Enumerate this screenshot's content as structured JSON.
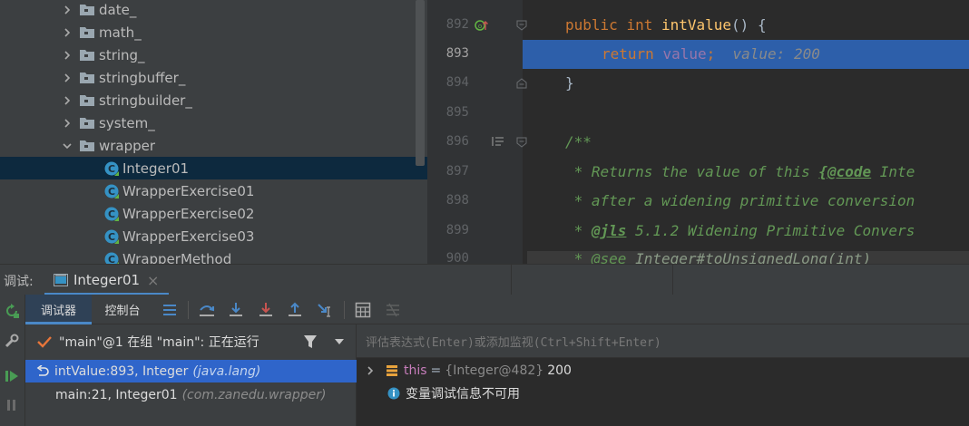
{
  "project_tree": {
    "items": [
      {
        "label": "date_",
        "kind": "folder",
        "expanded": false
      },
      {
        "label": "math_",
        "kind": "folder",
        "expanded": false
      },
      {
        "label": "string_",
        "kind": "folder",
        "expanded": false
      },
      {
        "label": "stringbuffer_",
        "kind": "folder",
        "expanded": false
      },
      {
        "label": "stringbuilder_",
        "kind": "folder",
        "expanded": false
      },
      {
        "label": "system_",
        "kind": "folder",
        "expanded": false
      },
      {
        "label": "wrapper",
        "kind": "folder",
        "expanded": true
      },
      {
        "label": "Integer01",
        "kind": "class",
        "selected": true
      },
      {
        "label": "WrapperExercise01",
        "kind": "class"
      },
      {
        "label": "WrapperExercise02",
        "kind": "class"
      },
      {
        "label": "WrapperExercise03",
        "kind": "class"
      },
      {
        "label": "WrapperMethod",
        "kind": "class"
      }
    ]
  },
  "editor": {
    "lines": [
      {
        "num": "892"
      },
      {
        "num": "893"
      },
      {
        "num": "894"
      },
      {
        "num": "895"
      },
      {
        "num": "896"
      },
      {
        "num": "897"
      },
      {
        "num": "898"
      },
      {
        "num": "899"
      },
      {
        "num": "900"
      }
    ],
    "code": {
      "l892_kw1": "public",
      "l892_kw2": "int",
      "l892_fn": "intValue",
      "l892_rest": "() {",
      "l893_kw": "return",
      "l893_var": "value",
      "l893_semi": ";",
      "l893_inline": "value: 200",
      "l894": "}",
      "l896": "/**",
      "l897_a": " * Returns the value of this ",
      "l897_tag": "{@code",
      "l897_b": " Inte",
      "l898": " * after a widening primitive conversion",
      "l899_a": " * ",
      "l899_tag": "@jls",
      "l899_b": " 5.1.2 Widening Primitive Convers",
      "l900_a": " * @see ",
      "l900_b": "Integer#toUnsignedLong(int)"
    }
  },
  "debug": {
    "title": "调试:",
    "session_tab": "Integer01",
    "close_glyph": "×",
    "tabs": {
      "debugger": "调试器",
      "console": "控制台"
    },
    "thread": "\"main\"@1 在组 \"main\": 正在运行",
    "frames": [
      {
        "name": "intValue:893, Integer",
        "pkg": "(java.lang)",
        "selected": true
      },
      {
        "name": "main:21, Integer01",
        "pkg": "(com.zanedu.wrapper)",
        "selected": false
      }
    ],
    "watch_placeholder": "评估表达式(Enter)或添加监视(Ctrl+Shift+Enter)",
    "variables": {
      "this_name": "this",
      "this_eq": "=",
      "this_type": "{Integer@482}",
      "this_value": "200",
      "info": "变量调试信息不可用"
    }
  },
  "colors": {
    "accent": "#4a88c7",
    "selection": "#2f65ca",
    "exec_line": "#2d5faa",
    "run_green": "#499c54",
    "stop_red": "#c75450"
  }
}
